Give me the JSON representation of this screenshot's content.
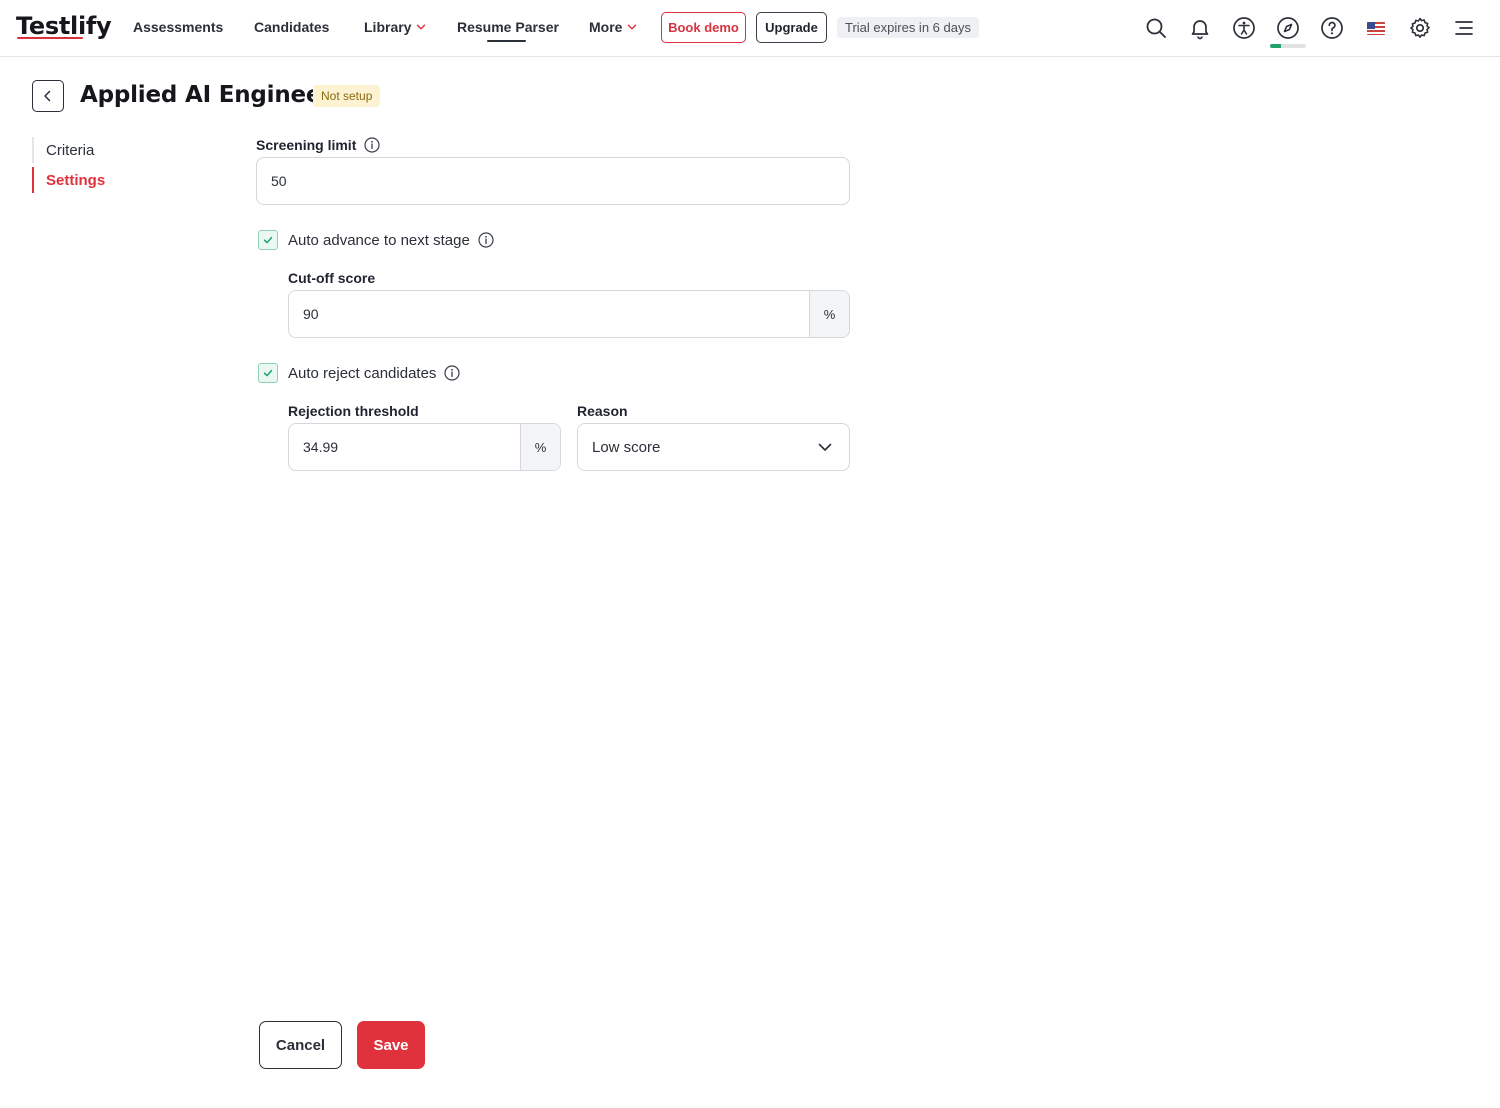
{
  "app": {
    "logo_text": "Testlify"
  },
  "nav": {
    "items": [
      {
        "label": "Assessments"
      },
      {
        "label": "Candidates"
      },
      {
        "label": "Library"
      },
      {
        "label": "Resume Parser"
      },
      {
        "label": "More"
      }
    ],
    "active_item": "Resume Parser",
    "book_demo_label": "Book demo",
    "upgrade_label": "Upgrade",
    "trial_text": "Trial expires in 6 days",
    "icons": [
      "search-icon",
      "bell-icon",
      "accessibility-icon",
      "compass-icon",
      "help-icon",
      "us-flag-icon",
      "gear-icon",
      "menu-icon"
    ],
    "onboarding_progress": 0.3
  },
  "page": {
    "title": "Applied AI Engineer",
    "status": "Not setup"
  },
  "sidebar": {
    "tabs": [
      {
        "label": "Criteria"
      },
      {
        "label": "Settings"
      }
    ],
    "active_tab": "Settings"
  },
  "form": {
    "screening_limit": {
      "label": "Screening limit",
      "value": "50"
    },
    "auto_advance": {
      "label": "Auto advance to next stage",
      "checked": true,
      "cutoff_label": "Cut-off score",
      "cutoff_value": "90",
      "cutoff_suffix": "%"
    },
    "auto_reject": {
      "label": "Auto reject candidates",
      "checked": true,
      "threshold_label": "Rejection threshold",
      "threshold_value": "34.99",
      "threshold_suffix": "%",
      "reason_label": "Reason",
      "reason_value": "Low score"
    }
  },
  "footer": {
    "cancel_label": "Cancel",
    "save_label": "Save"
  },
  "colors": {
    "brand_red": "#e0323d",
    "checkbox_green": "#1fa36b",
    "status_badge_bg": "#fdf3d2"
  }
}
